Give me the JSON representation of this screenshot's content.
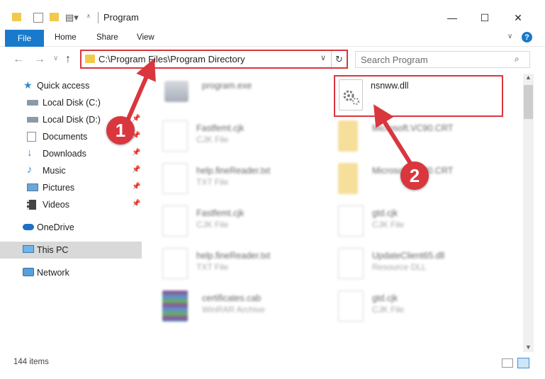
{
  "window": {
    "title": "Program",
    "controls": {
      "minimize": "—",
      "maximize": "☐",
      "close": "✕"
    }
  },
  "ribbon": {
    "tabs": [
      {
        "label": "File"
      },
      {
        "label": "Home"
      },
      {
        "label": "Share"
      },
      {
        "label": "View"
      }
    ],
    "help": "?"
  },
  "navigation": {
    "address": "C:\\Program Files\\Program Directory",
    "search_placeholder": "Search Program"
  },
  "sidebar": {
    "items": [
      {
        "label": "Quick access",
        "icon": "star-icon"
      },
      {
        "label": "Local Disk (C:)",
        "icon": "drive-icon"
      },
      {
        "label": "Local Disk (D:)",
        "icon": "drive-icon"
      },
      {
        "label": "Documents",
        "icon": "documents-icon"
      },
      {
        "label": "Downloads",
        "icon": "download-icon"
      },
      {
        "label": "Music",
        "icon": "music-icon"
      },
      {
        "label": "Pictures",
        "icon": "pictures-icon"
      },
      {
        "label": "Videos",
        "icon": "videos-icon"
      },
      {
        "label": "OneDrive",
        "icon": "cloud-icon"
      },
      {
        "label": "This PC",
        "icon": "computer-icon",
        "selected": true
      },
      {
        "label": "Network",
        "icon": "network-icon"
      }
    ]
  },
  "files": {
    "left": [
      {
        "name": "program.exe",
        "type": ""
      },
      {
        "name": "Fastfemt.cjk",
        "type": "CJK File"
      },
      {
        "name": "help.fineReader.txt",
        "type": "TXT File"
      },
      {
        "name": "Fastfemt.cjk",
        "type": "CJK File"
      },
      {
        "name": "help.fineReader.txt",
        "type": "TXT File"
      },
      {
        "name": "certificates.cab",
        "type": "WinRAR Archive"
      }
    ],
    "right": [
      {
        "name": "nsnww.dll",
        "type": ""
      },
      {
        "name": "Microsoft.VC90.CRT",
        "type": ""
      },
      {
        "name": "Microsoft.VC90.CRT",
        "type": ""
      },
      {
        "name": "gtd.cjk",
        "type": "CJK File"
      },
      {
        "name": "UpdateClient65.dll",
        "type": "Resource DLL"
      },
      {
        "name": "gtd.cjk",
        "type": "CJK File"
      }
    ]
  },
  "status": {
    "item_count": "144 items"
  },
  "callouts": {
    "one": "1",
    "two": "2"
  },
  "colors": {
    "accent": "#1979ca",
    "highlight": "#d9363e",
    "selection": "#d9d9d9"
  }
}
